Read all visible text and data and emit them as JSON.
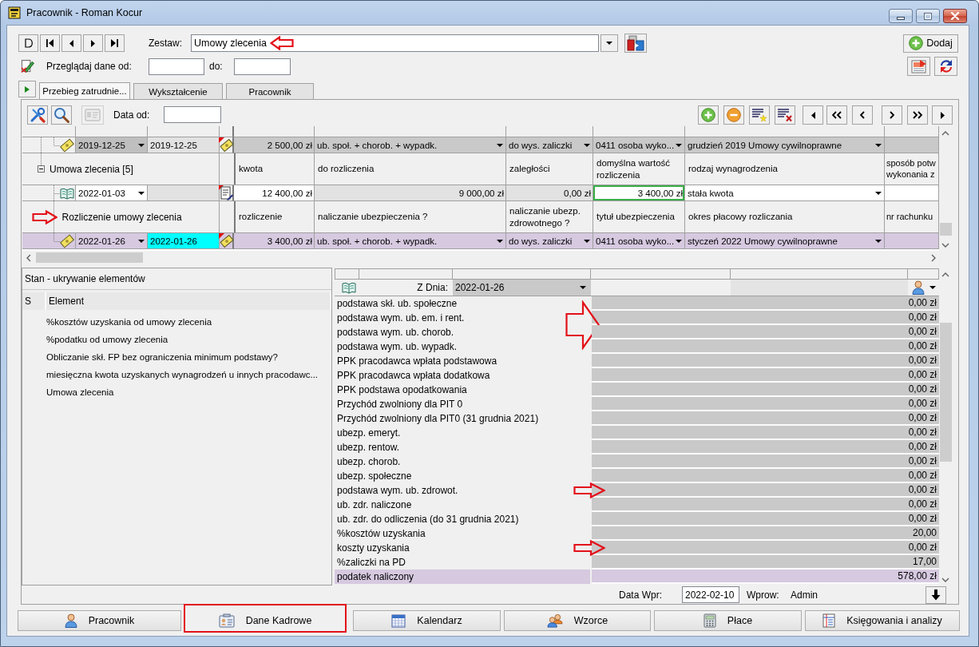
{
  "window": {
    "title": "Pracownik - Roman Kocur"
  },
  "header": {
    "set_label": "Zestaw:",
    "set_value": "Umowy zlecenia",
    "set_annotated": true,
    "browse_label": "Przeglądaj dane od:",
    "browse_to_label": "do:",
    "add_button": "Dodaj"
  },
  "tabs": [
    {
      "label": "Przebieg zatrudnie...",
      "selected": true
    },
    {
      "label": "Wykształcenie",
      "selected": false
    },
    {
      "label": "Pracownik",
      "selected": false
    }
  ],
  "grid_toolbar": {
    "date_label": "Data od:"
  },
  "grid": {
    "groups": [
      {
        "children": [
          {
            "kind": "settlement",
            "selected": false,
            "date": "2019-12-25",
            "date_to": "2019-12-25",
            "amount": "2 500,00 zł",
            "insurance": "ub. społ. + chorob. + wypadk.",
            "health_insurance": "do wys. zaliczki",
            "insurance_title": "0411 osoba wyko...",
            "payroll_period": "grudzień 2019 Umowy cywilnoprawne"
          }
        ]
      },
      {
        "title": "Umowa zlecenia [5]",
        "expanded": true,
        "labels": [
          "kwota",
          "do rozliczenia",
          "zaległości",
          "domyślna wartość rozliczenia",
          "rodzaj wynagrodzenia",
          "sposób potw wykonania z"
        ],
        "children": [
          {
            "kind": "contract",
            "selected": false,
            "date": "2022-01-03",
            "amount": "12 400,00 zł",
            "to_settle": "9 000,00 zł",
            "arrears": "0,00 zł",
            "default_settlement": "3 400,00 zł",
            "default_settlement_focused": true,
            "remuneration_type": "stała kwota"
          },
          {
            "kind": "header",
            "title": "Rozliczenie umowy zlecenia",
            "annotated": true,
            "labels": [
              "rozliczenie",
              "naliczanie ubezpieczenia ?",
              "naliczanie ubezp. zdrowotnego ?",
              "tytuł ubezpieczenia",
              "okres płacowy rozliczania",
              "nr rachunku"
            ]
          },
          {
            "kind": "settlement",
            "selected": true,
            "date": "2022-01-26",
            "date_to": "2022-01-26",
            "amount": "3 400,00 zł",
            "insurance": "ub. społ. + chorob. + wypadk.",
            "health_insurance": "do wys. zaliczki",
            "insurance_title": "0411 osoba wyko...",
            "payroll_period": "styczeń 2022 Umowy cywilnoprawne"
          }
        ]
      }
    ]
  },
  "hidden_elements": {
    "title": "Stan - ukrywanie elementów",
    "columns": [
      "S",
      "Element"
    ],
    "items": [
      "%kosztów uzyskania od umowy zlecenia",
      "%podatku od umowy zlecenia",
      "Obliczanie skł. FP bez ograniczenia minimum podstawy?",
      "miesięczna kwota uzyskanych wynagrodzeń u innych pracodawc...",
      "Umowa zlecenia"
    ]
  },
  "details": {
    "date_label": "Z Dnia:",
    "date": "2022-01-26",
    "rows": [
      {
        "label": "podstawa skł. ub. społeczne",
        "value": "0,00 zł",
        "selected": false
      },
      {
        "label": "podstawa wym. ub. em. i rent.",
        "value": "0,00 zł",
        "selected": false,
        "annotation": {
          "kind": "large-arrow"
        }
      },
      {
        "label": "podstawa wym. ub. chorob.",
        "value": "0,00 zł",
        "selected": false
      },
      {
        "label": "podstawa wym. ub. wypadk.",
        "value": "0,00 zł",
        "selected": false
      },
      {
        "label": "PPK pracodawca wpłata podstawowa",
        "value": "0,00 zł",
        "selected": false
      },
      {
        "label": "PPK pracodawca wpłata dodatkowa",
        "value": "0,00 zł",
        "selected": false
      },
      {
        "label": "PPK podstawa opodatkowania",
        "value": "0,00 zł",
        "selected": false
      },
      {
        "label": "Przychód zwolniony dla PIT 0",
        "value": "0,00 zł",
        "selected": false
      },
      {
        "label": "Przychód zwolniony dla PIT0 (31 grudnia 2021)",
        "value": "0,00 zł",
        "selected": false
      },
      {
        "label": "ubezp. emeryt.",
        "value": "0,00 zł",
        "selected": false
      },
      {
        "label": "ubezp. rentow.",
        "value": "0,00 zł",
        "selected": false
      },
      {
        "label": "ubezp. chorob.",
        "value": "0,00 zł",
        "selected": false
      },
      {
        "label": "ubezp. społeczne",
        "value": "0,00 zł",
        "selected": false
      },
      {
        "label": "podstawa wym. ub. zdrowot.",
        "value": "0,00 zł",
        "selected": false,
        "annotation": {
          "kind": "arrow"
        }
      },
      {
        "label": "ub. zdr. naliczone",
        "value": "0,00 zł",
        "selected": false
      },
      {
        "label": "ub. zdr. do odliczenia (do 31 grudnia 2021)",
        "value": "0,00 zł",
        "selected": false
      },
      {
        "label": "%kosztów uzyskania",
        "value": "20,00",
        "selected": false
      },
      {
        "label": "koszty uzyskania",
        "value": "0,00 zł",
        "selected": false,
        "annotation": {
          "kind": "arrow"
        }
      },
      {
        "label": "%zaliczki na PD",
        "value": "17,00",
        "selected": false
      },
      {
        "label": "podatek naliczony",
        "value": "578,00 zł",
        "selected": true
      }
    ],
    "entry_date_label": "Data Wpr:",
    "entry_date": "2022-02-10",
    "entered_by_label": "Wprow:",
    "entered_by": "Admin"
  },
  "bottom_tabs": [
    {
      "label": "Pracownik",
      "selected": false,
      "annotated": false
    },
    {
      "label": "Dane Kadrowe",
      "selected": true,
      "annotated": true
    },
    {
      "label": "Kalendarz",
      "selected": false,
      "annotated": false
    },
    {
      "label": "Wzorce",
      "selected": false,
      "annotated": false
    },
    {
      "label": "Płace",
      "selected": false,
      "annotated": false
    },
    {
      "label": "Księgowania i analizy",
      "selected": false,
      "annotated": false
    }
  ]
}
